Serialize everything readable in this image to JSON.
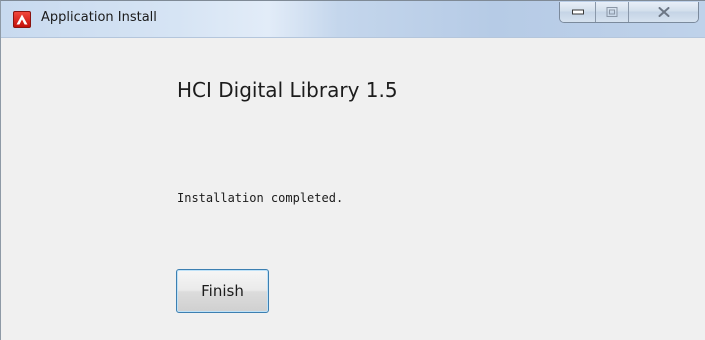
{
  "window": {
    "title": "Application Install",
    "app_icon": "adobe-air-icon",
    "controls": {
      "minimize": "minimize-icon",
      "maximize": "maximize-icon",
      "close": "close-icon"
    }
  },
  "content": {
    "app_name": "HCI Digital Library 1.5",
    "status": "Installation completed.",
    "finish_label": "Finish"
  },
  "colors": {
    "window_bg": "#f0f0f0",
    "titlebar": "#c8daef",
    "app_icon": "#d91d14",
    "button_focus_border": "#3c7fb1"
  }
}
